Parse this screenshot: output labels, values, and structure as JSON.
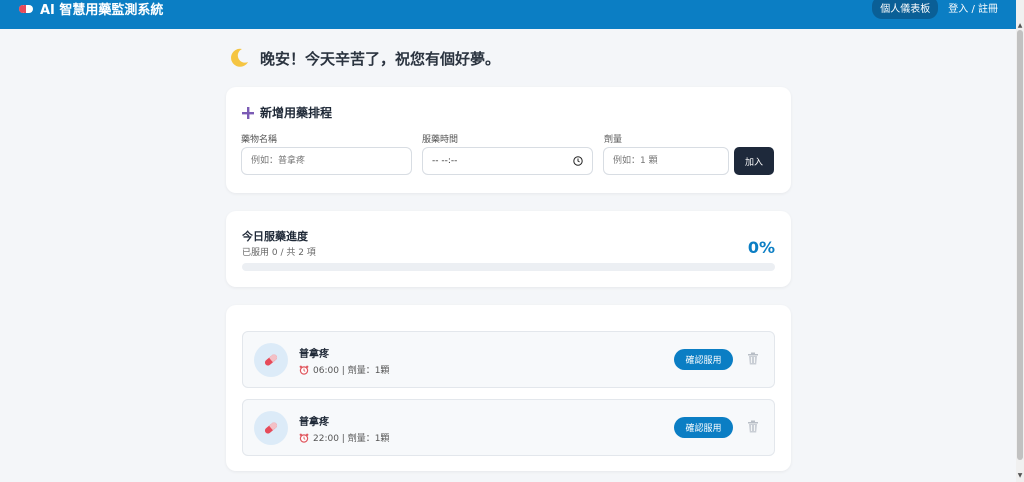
{
  "navbar": {
    "brand": "AI 智慧用藥監測系統",
    "dashboard_label": "個人儀表板",
    "login_label": "登入 / 註冊"
  },
  "greeting": "晚安！今天辛苦了，祝您有個好夢。",
  "add_form": {
    "title": "新增用藥排程",
    "name_label": "藥物名稱",
    "name_placeholder": "例如：普拿疼",
    "time_label": "服藥時間",
    "time_value": "-- --:--",
    "dose_label": "劑量",
    "dose_placeholder": "例如：1 顆",
    "add_button": "加入"
  },
  "progress": {
    "title": "今日服藥進度",
    "subtitle": "已服用 0 / 共 2 項",
    "percent_label": "0%",
    "fraction": 0
  },
  "medications": [
    {
      "name": "普拿疼",
      "meta": "06:00 | 劑量：1顆",
      "confirm_label": "確認服用"
    },
    {
      "name": "普拿疼",
      "meta": "22:00 | 劑量：1顆",
      "confirm_label": "確認服用"
    }
  ],
  "colors": {
    "primary": "#0b7ec4",
    "dark_button": "#1e293b",
    "background": "#f4f6f9"
  },
  "icons": [
    "pill-icon",
    "moon-icon",
    "plus-icon",
    "clock-icon",
    "alarm-clock-icon",
    "trash-icon"
  ]
}
